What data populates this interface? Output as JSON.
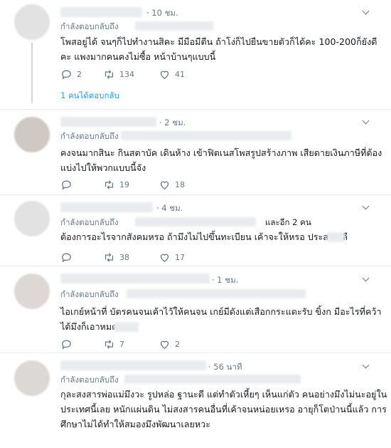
{
  "tweets": [
    {
      "time": "· 10 ชม.",
      "reply_prefix": "กำลังตอบกลับถึง",
      "reply_suffix": "",
      "lines": [
        "โพสอยู่ได้ จนๆก็ไปทำงานสิคะ มีมือมีตีน ถ้าโง่ก็ไปยืนขายตัวก็ได้คะ 100-200ก็ยังดี",
        "คะ แพงมากคนคงไม่ซื้อ หน้าบ้านๆแบบนี้"
      ],
      "replies": "2",
      "retweets": "134",
      "likes": "41",
      "more_replies": "1 คนได้ตอบกลับ"
    },
    {
      "time": "· 2 ชม.",
      "reply_prefix": "กำลังตอบกลับถึง",
      "reply_suffix": "",
      "lines": [
        "คงจนมากสินะ กินสตาบัค เดินห้าง เข้าฟิตเนสโพสรูปสร้างภาพ เสียดายเงินภาษีที่ต้อง",
        "แบ่งไปให้พวกแบบนี้จัง"
      ],
      "replies": "",
      "retweets": "19",
      "likes": "18"
    },
    {
      "time": "· 4 ชม.",
      "reply_prefix": "กำลังตอบกลับถึง",
      "reply_suffix": "และอีก 2 คน",
      "lines": [
        "ต้องการอะไรจากสังคมหรอ ถ้ามึงไม่ไปขึ้นทะเบียน เค้าจะให้หรอ ประสาท ลื"
      ],
      "replies": "",
      "retweets": "38",
      "likes": "17"
    },
    {
      "time": "· 1 ชม.",
      "reply_prefix": "กำลังตอบกลับถึง",
      "reply_suffix": "",
      "lines": [
        "ไอเกย์หน้าที่ บัตรคนจนเค้าไว้ให้คนจน เกย์มีดังแต่เสือกกระแดะรับ ขิ้งก มีอะไรที่คว้า",
        "ได้มึงก็เอาหมด"
      ],
      "replies": "",
      "retweets": "7",
      "likes": "2"
    },
    {
      "time": "· 56 นาที",
      "reply_prefix": "กำลังตอบกลับถึง",
      "reply_suffix": "",
      "lines": [
        "กุละสงสารพ่อแม่มึงวะ รูปหล่อ ฐานะดี แต่ทำตัวเหี้ยๆ เห็นแก่ตัว คนอย่างมึงไม่นะอยู่ใน",
        "ประเทศนี้เลย หนักแผ่นดิน ไม่สงสารคนอื่นที่เค้าจนหน่อยเหรอ อายุก็โตป่านนี้แล้ว การ",
        "ศึกษาไม่ได้ทำให้สมองมึงพัฒนาเลยหวะ"
      ],
      "replies": "",
      "retweets": "",
      "likes": ""
    }
  ]
}
